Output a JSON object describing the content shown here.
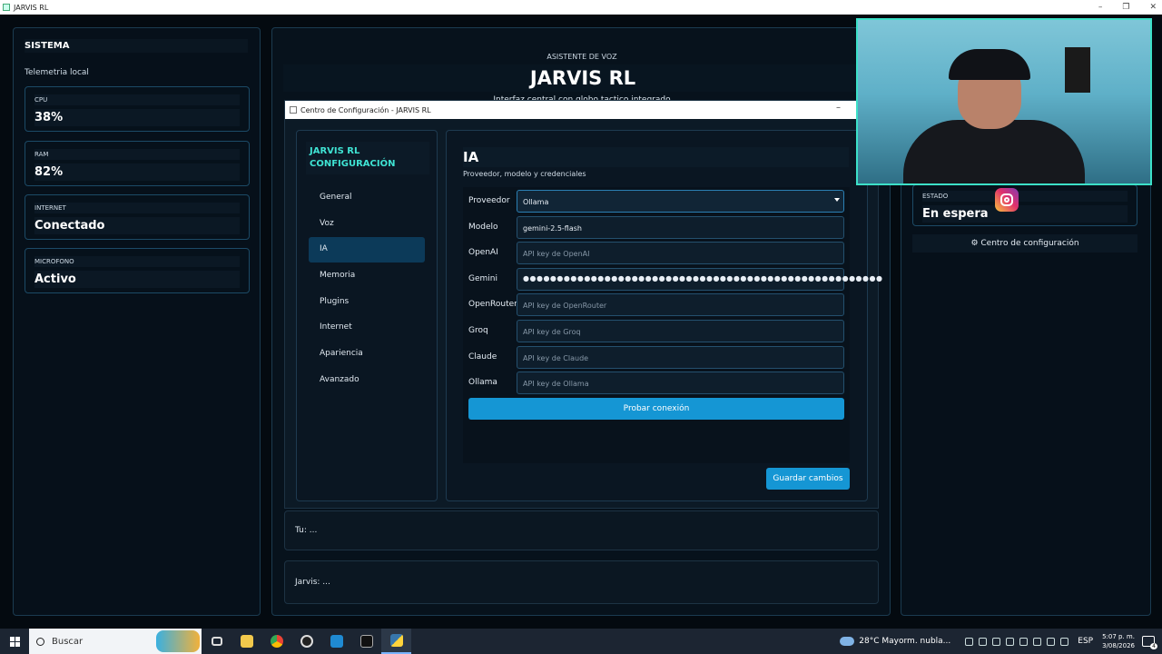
{
  "window": {
    "title": "JARVIS RL",
    "controls": [
      "–",
      "❐",
      "✕"
    ]
  },
  "left": {
    "title": "SISTEMA",
    "subtitle": "Telemetria local",
    "metrics": [
      {
        "label": "CPU",
        "value": "38%"
      },
      {
        "label": "RAM",
        "value": "82%"
      },
      {
        "label": "INTERNET",
        "value": "Conectado"
      },
      {
        "label": "MICROFONO",
        "value": "Activo"
      }
    ]
  },
  "header": {
    "eyebrow": "ASISTENTE DE VOZ",
    "title": "JARVIS RL",
    "description": "Interfaz central con globo tactico integrado"
  },
  "config_window": {
    "title": "Centro de Configuración - JARVIS RL",
    "brand_line1": "JARVIS RL",
    "brand_line2": "CONFIGURACIÓN",
    "nav": [
      "General",
      "Voz",
      "IA",
      "Memoria",
      "Plugins",
      "Internet",
      "Apariencia",
      "Avanzado"
    ],
    "active_nav": "IA",
    "section_title": "IA",
    "section_subtitle": "Proveedor, modelo y credenciales",
    "fields": [
      {
        "label": "Proveedor",
        "value": "Ollama",
        "placeholder": ""
      },
      {
        "label": "Modelo",
        "value": "gemini-2.5-flash",
        "placeholder": ""
      },
      {
        "label": "OpenAI",
        "value": "",
        "placeholder": "API key de OpenAI"
      },
      {
        "label": "Gemini",
        "value": "●●●●●●●●●●●●●●●●●●●●●●●●●●●●●●●●●●●●●●●●●●●●●●●●●●●●●",
        "placeholder": ""
      },
      {
        "label": "OpenRouter",
        "value": "",
        "placeholder": "API key de OpenRouter"
      },
      {
        "label": "Groq",
        "value": "",
        "placeholder": "API key de Groq"
      },
      {
        "label": "Claude",
        "value": "",
        "placeholder": "API key de Claude"
      },
      {
        "label": "Ollama",
        "value": "",
        "placeholder": "API key de Ollama"
      }
    ],
    "test_button": "Probar conexión",
    "save_button": "Guardar cambios"
  },
  "chat": {
    "user": "Tu: ...",
    "assistant": "Jarvis: ..."
  },
  "right": {
    "status_label": "ESTADO",
    "status_value": "En espera",
    "config_link": "⚙ Centro de configuración"
  },
  "taskbar": {
    "search_placeholder": "Buscar",
    "weather": "28°C  Mayorm. nubla...",
    "lang": "ESP",
    "time": "5:07 p. m.",
    "date": "3/08/2026",
    "notifications": "4"
  }
}
